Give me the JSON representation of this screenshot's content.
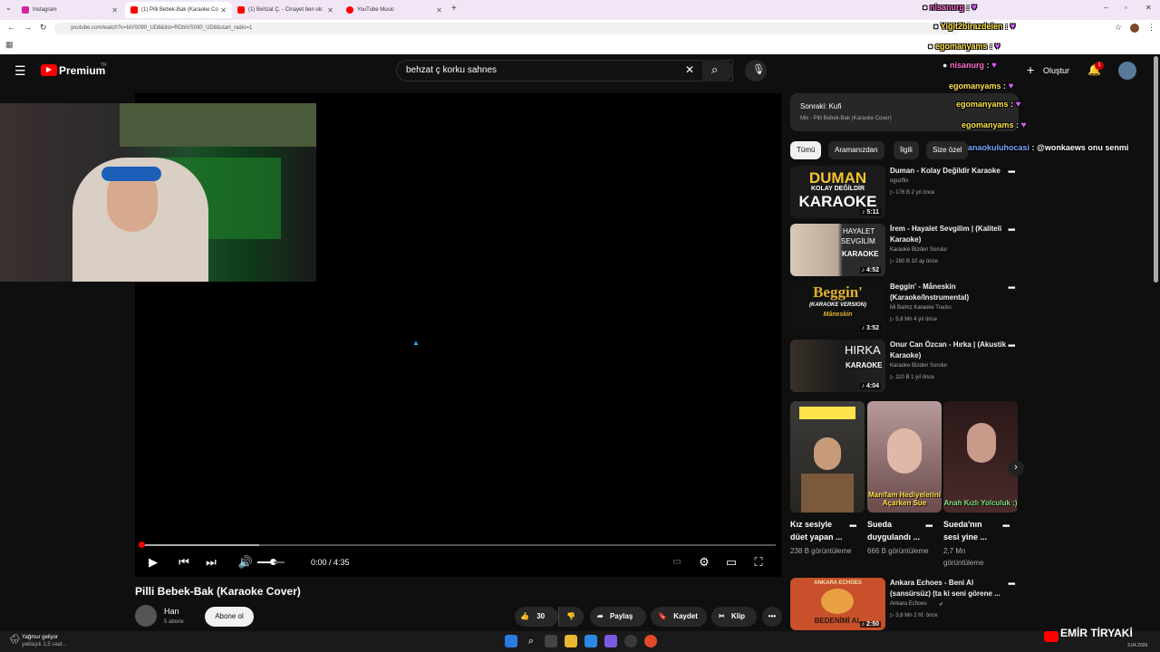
{
  "browser": {
    "tabs": [
      {
        "label": "Instagram",
        "icon_color": "#d6249f"
      },
      {
        "label": "(1) Pilli Bebek-Bak (Karaoke Co",
        "icon_color": "#ff0000"
      },
      {
        "label": "(1) Behzat Ç. - Cinayet ben olc",
        "icon_color": "#ff0000"
      },
      {
        "label": "YouTube Music",
        "icon_color": "#ff0000"
      }
    ],
    "new_tab": "+",
    "url": "youtube.com/watch?v=biVS090_UD8&list=RDbiVS090_UD8&start_radio=1"
  },
  "youtube": {
    "logo": "Premium",
    "logo_region": "TR",
    "search_value": "behzat ç korku sahnes",
    "create_label": "Oluştur",
    "notification_count": "1"
  },
  "player": {
    "time": "0:00 / 4:35",
    "progress": 0.0,
    "title": "Pilli Bebek-Bak (Karaoke Cover)",
    "channel": "Han",
    "subscribers": "5 abone",
    "subscribe_label": "Abone ol",
    "likes": "30",
    "share_label": "Paylaş",
    "save_label": "Kaydet",
    "clip_label": "Klip"
  },
  "up_next": {
    "label": "Sonraki: Kufi",
    "sub": "Mix - Pilli Bebek-Bak (Karaoke Cover)"
  },
  "chips": [
    "Tümü",
    "Aramanızdan",
    "İlgili",
    "Size özel"
  ],
  "videos": [
    {
      "title": "Duman - Kolay Değildir Karaoke",
      "channel": "oguzflix",
      "meta": "▷ 176 B  2 yıl önce",
      "duration": "♪ 5:11",
      "thumb_text1": "DUMAN",
      "thumb_text2": "KOLAY DEĞİLDİR",
      "thumb_text3": "KARAOKE",
      "thumb_bg": "#1a1a1a",
      "thumb_color": "#f4c430"
    },
    {
      "title": "İrem - Hayalet Sevgilim | (Kaliteli Karaoke)",
      "channel": "Karaoke Bizden Sorulur",
      "meta": "▷ 280 B  10 ay önce",
      "duration": "♪ 4:52",
      "thumb_text1": "HAYALET",
      "thumb_text2": "SEVGİLİM",
      "thumb_text3": "KARAOKE",
      "thumb_bg": "#2b2b2b",
      "thumb_color": "#ffffff"
    },
    {
      "title": "Beggin' - Måneskin (Karaoke/Instrumental)",
      "channel": "Mi Balmz Karaoke Tracks",
      "meta": "▷ 5,8 Mn  4 yıl önce",
      "duration": "♪ 3:52",
      "thumb_text1": "Beggin'",
      "thumb_text2": "(KARAOKE VERSION)",
      "thumb_text3": "Måneskin",
      "thumb_bg": "#111111",
      "thumb_color": "#e0b030"
    },
    {
      "title": "Onur Can Özcan - Hırka | (Akustik Karaoke)",
      "channel": "Karaoke Bizden Sorulur",
      "meta": "▷ 110 B  1 yıl önce",
      "duration": "♪ 4:04",
      "thumb_text1": "HIRKA",
      "thumb_text2": "",
      "thumb_text3": "KARAOKE",
      "thumb_bg": "#222222",
      "thumb_color": "#ffffff"
    }
  ],
  "shorts": [
    {
      "title": "Kız sesiyle düet yapan ...",
      "views": "238 B görüntüleme",
      "caption": "",
      "bg": "#3a3a38"
    },
    {
      "title": "Sueda duygulandı ...",
      "views": "666 B görüntüleme",
      "caption": "Manifam Hediyelerini Açarken Sue",
      "bg": "#8a6a6a"
    },
    {
      "title": "Sueda'nın sesi yine ...",
      "views": "2,7 Mn görüntüleme",
      "caption": "Anah Kızlı Yolculuk :)",
      "bg": "#3a2020"
    }
  ],
  "last_video": {
    "title": "Ankara Echoes - Beni Al (sansürsüz) (ta ki seni görene ...",
    "channel": "Ankara Echoes",
    "meta": "▷ 3,8 Mn  2 hf. önce",
    "duration": "♪ 2:50",
    "thumb_text1": "ANKARA ECHOES",
    "thumb_text3": "BEDENİMİ AL"
  },
  "chat": [
    {
      "user": "nisanurg",
      "text": ":",
      "color": "#ff6ed0"
    },
    {
      "user": "Yiğit2birazdelen",
      "text": ":",
      "color": "#ffe34d"
    },
    {
      "user": "egomanyams",
      "text": ":",
      "color": "#ffe34d"
    },
    {
      "user": "nisanurg",
      "text": ":",
      "color": "#ff6ed0"
    },
    {
      "user": "egomanyams",
      "text": ":",
      "color": "#ffe34d"
    },
    {
      "user": "egomanyams",
      "text": ":",
      "color": "#ffe34d"
    },
    {
      "user": "egomanyams",
      "text": ":",
      "color": "#ffe34d"
    },
    {
      "user": "anaokuluhocasi",
      "text": ": @wonkaews onu senmi",
      "color": "#7aa8ff"
    }
  ],
  "taskbar": {
    "weather_title": "Yağmur geliyor",
    "weather_sub": "yaklaşık 1,5 saat...",
    "brand": "EMİR TİRYAKİ",
    "date": "3.04.2026"
  }
}
